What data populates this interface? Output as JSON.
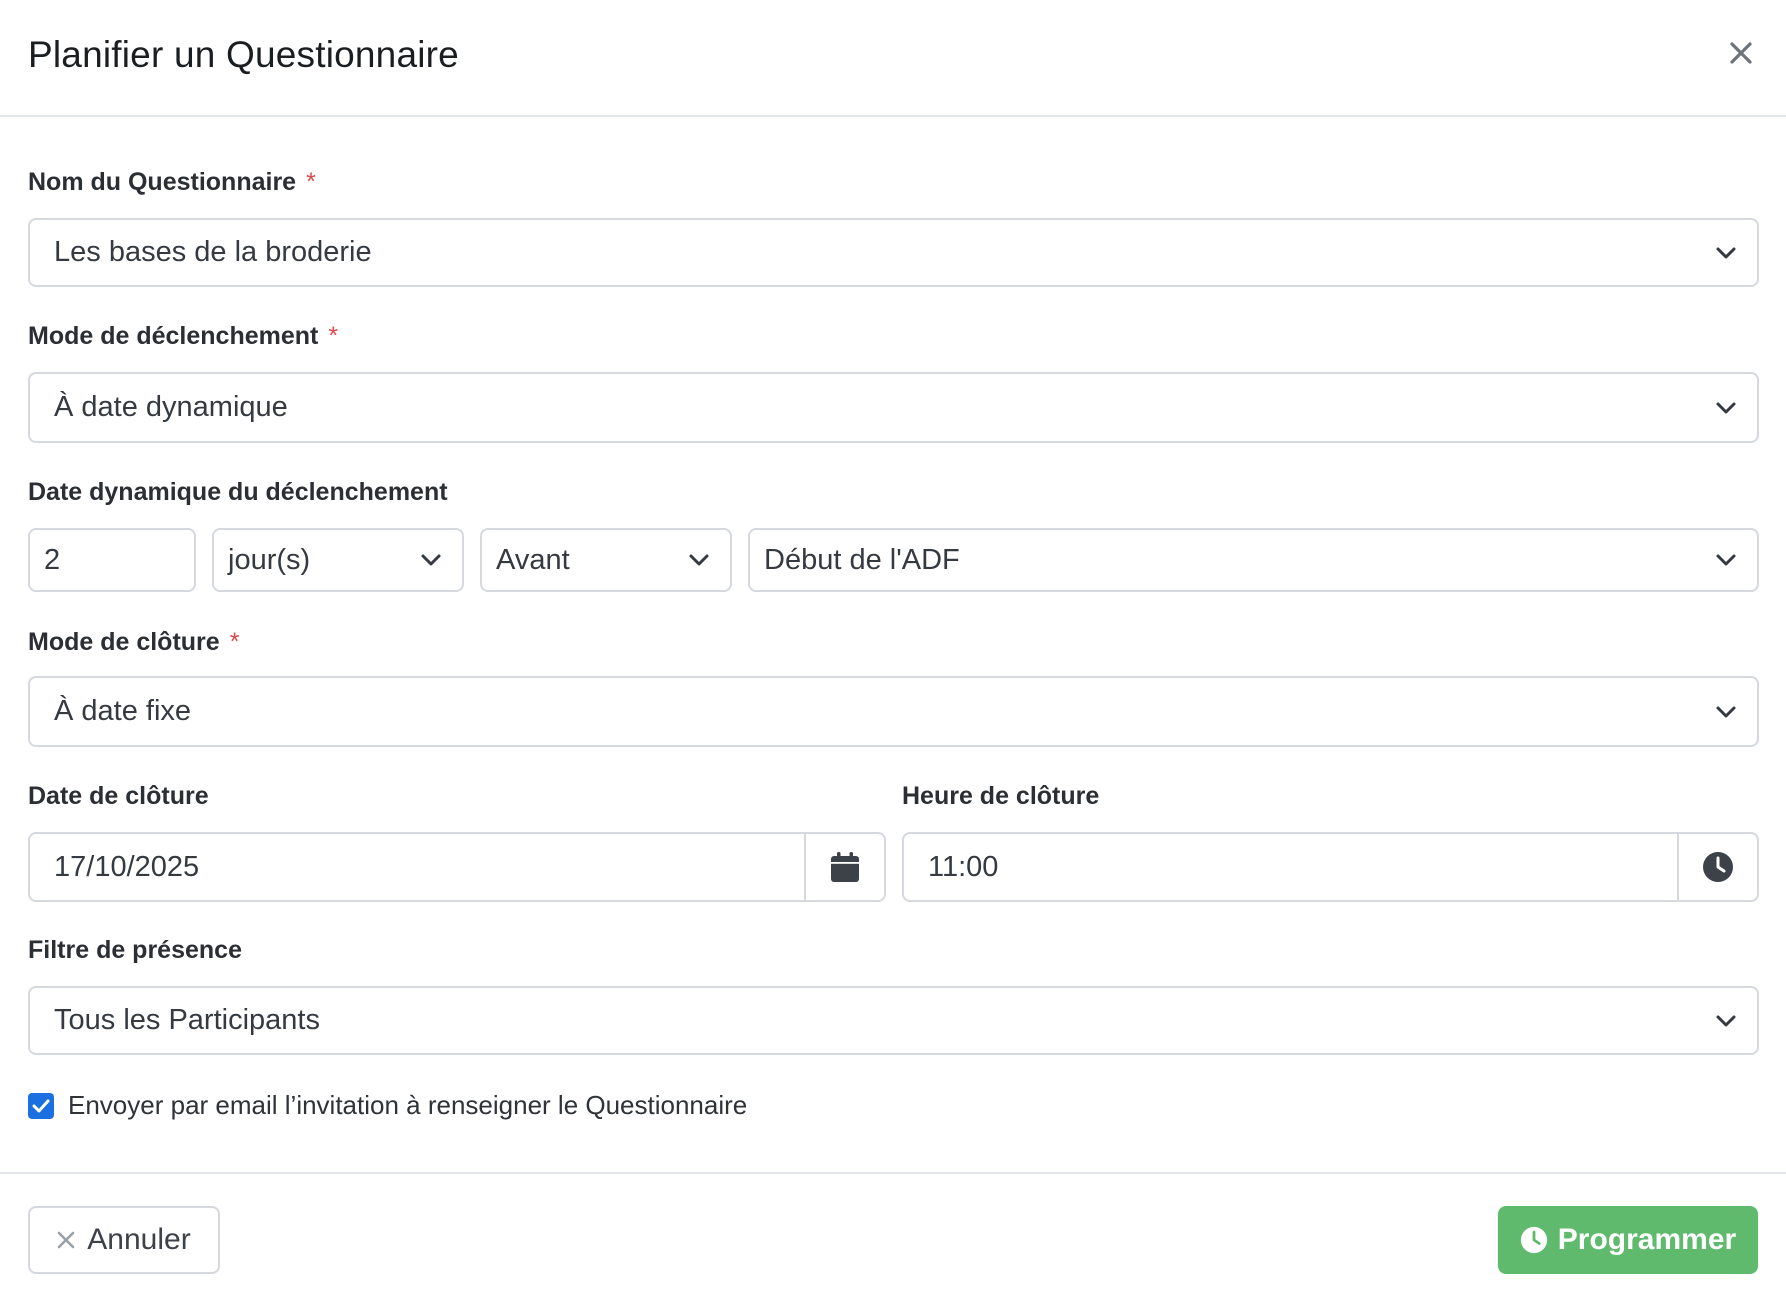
{
  "modal": {
    "title": "Planifier un Questionnaire"
  },
  "fields": {
    "questionnaire": {
      "label": "Nom du Questionnaire",
      "required_mark": "*",
      "value": "Les bases de la broderie"
    },
    "trigger_mode": {
      "label": "Mode de déclenchement",
      "required_mark": "*",
      "value": "À date dynamique"
    },
    "dynamic_date": {
      "label": "Date dynamique du déclenchement",
      "amount": "2",
      "unit": "jour(s)",
      "direction": "Avant",
      "reference": "Début de l'ADF"
    },
    "closing_mode": {
      "label": "Mode de clôture",
      "required_mark": "*",
      "value": "À date fixe"
    },
    "closing_date": {
      "label": "Date de clôture",
      "value": "17/10/2025"
    },
    "closing_time": {
      "label": "Heure de clôture",
      "value": "11:00"
    },
    "presence_filter": {
      "label": "Filtre de présence",
      "value": "Tous les Participants"
    },
    "email_invite": {
      "label": "Envoyer par email l’invitation à renseigner le Questionnaire",
      "checked": true
    }
  },
  "footer": {
    "cancel_label": "Annuler",
    "submit_label": "Programmer"
  },
  "colors": {
    "primary_check": "#1c6fe0",
    "submit_green": "#5fba6e",
    "required_red": "#e0484b",
    "border": "#d5d9de"
  },
  "icons": {
    "close": "close-icon",
    "chevron": "chevron-down-icon",
    "calendar": "calendar-icon",
    "clock": "clock-icon",
    "check": "check-icon",
    "cancel": "x-icon"
  }
}
